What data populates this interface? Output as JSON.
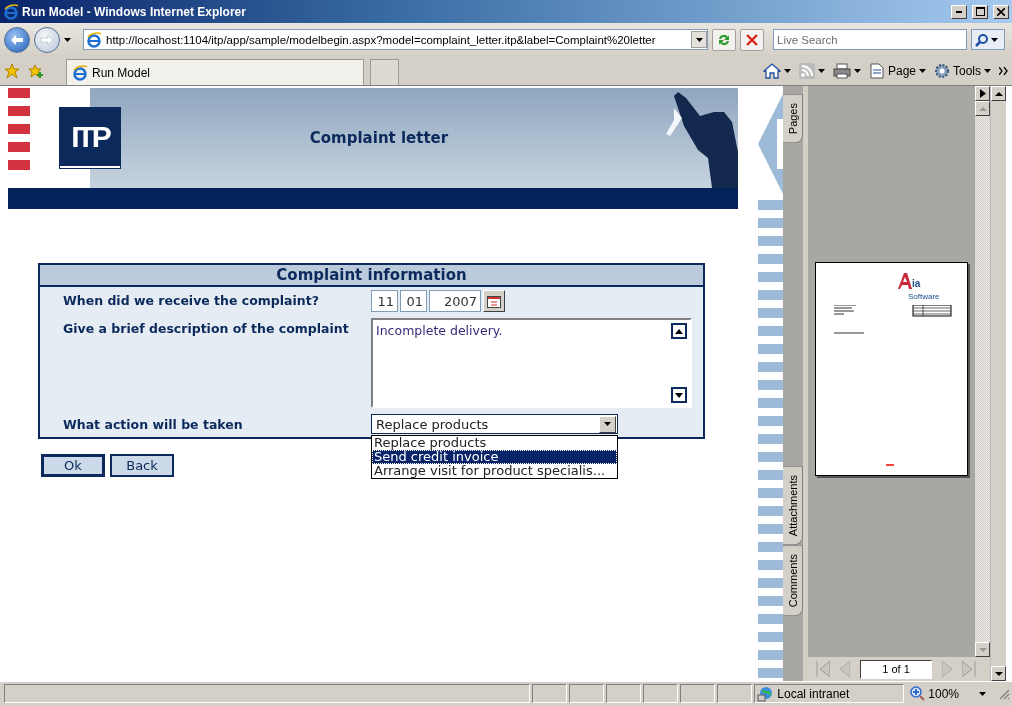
{
  "window": {
    "title": "Run Model - Windows Internet Explorer"
  },
  "address_bar": {
    "url": "http://localhost:1104/itp/app/sample/modelbegin.aspx?model=complaint_letter.itp&label=Complaint%20letter"
  },
  "search": {
    "placeholder": "Live Search"
  },
  "tabs": [
    {
      "label": "Run Model",
      "selected": true
    }
  ],
  "command_bar": [
    {
      "kind": "home"
    },
    {
      "kind": "feeds"
    },
    {
      "kind": "print"
    },
    {
      "kind": "page",
      "label": "Page"
    },
    {
      "kind": "tools",
      "label": "Tools"
    }
  ],
  "banner": {
    "logo_text": "ITP",
    "title": "Complaint letter"
  },
  "form": {
    "title": "Complaint information",
    "fields": [
      {
        "kind": "date",
        "label": "When did we receive the complaint?",
        "day": "11",
        "month": "01",
        "year": "2007"
      },
      {
        "kind": "textarea",
        "label": "Give a brief description of the complaint",
        "value": "Incomplete delivery."
      },
      {
        "kind": "select",
        "label": "What action will be taken",
        "value": "Replace products",
        "expanded": true,
        "options": [
          {
            "label": "Replace products",
            "highlighted": false
          },
          {
            "label": "Send credit invoice",
            "highlighted": true
          },
          {
            "label": "Arrange visit for product specialis...",
            "highlighted": false
          }
        ]
      }
    ]
  },
  "buttons": [
    {
      "label": "Ok",
      "default": true
    },
    {
      "label": "Back",
      "default": false
    }
  ],
  "pdf_viewer": {
    "side_tabs": [
      "Pages",
      "Attachments",
      "Comments"
    ],
    "preview": {
      "logo": "ia",
      "logo_sub": "Software"
    },
    "page_field": "1 of 1"
  },
  "status_bar": {
    "zone": "Local intranet",
    "zoom": "100%"
  }
}
